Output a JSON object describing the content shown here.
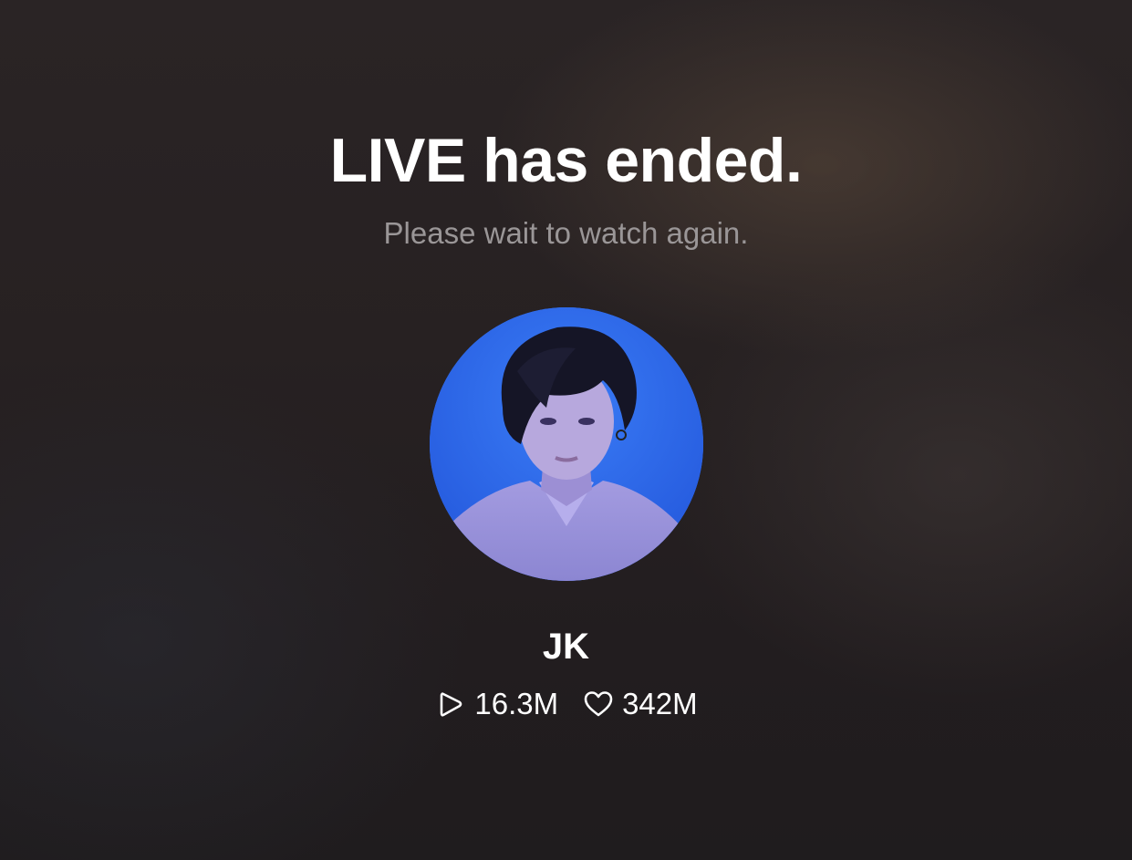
{
  "live_end": {
    "title": "LIVE has ended.",
    "subtitle": "Please wait to watch again."
  },
  "profile": {
    "name": "JK",
    "avatar_icon": "profile-photo",
    "accent_color": "#2f6ff0"
  },
  "stats": {
    "plays": {
      "icon": "play-icon",
      "value": "16.3M"
    },
    "likes": {
      "icon": "heart-icon",
      "value": "342M"
    }
  }
}
